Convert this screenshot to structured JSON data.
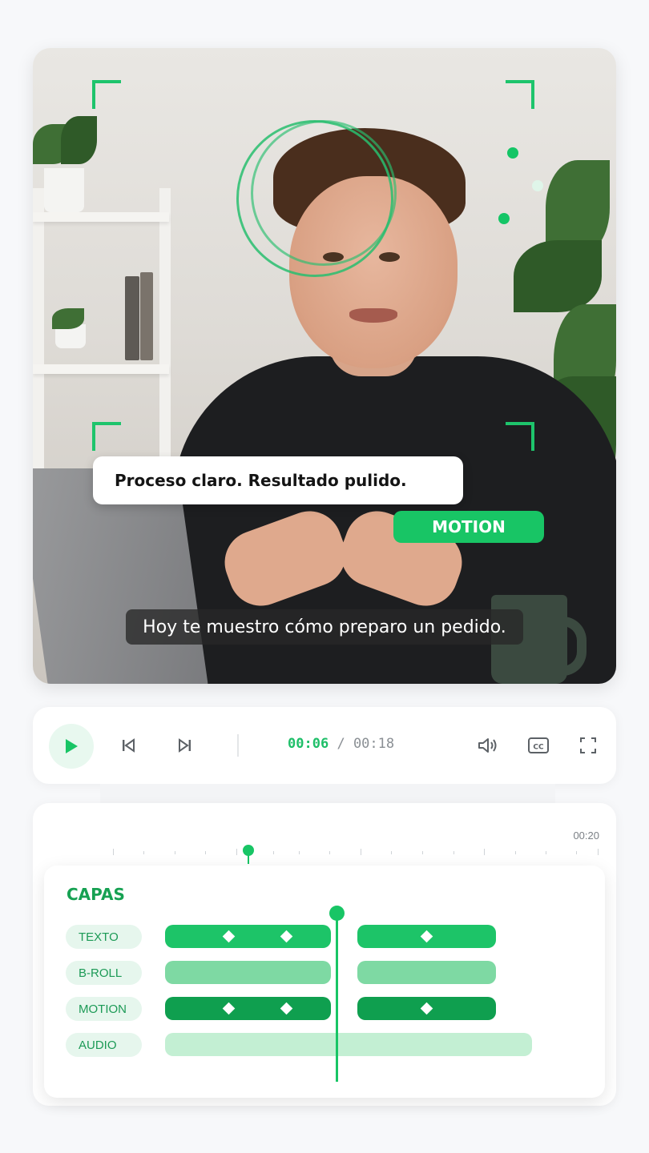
{
  "video": {
    "title_card": "Proceso claro. Resultado pulido.",
    "motion_tag": "MOTION",
    "subtitle": "Hoy te muestro cómo preparo un pedido."
  },
  "player": {
    "current_time": "00:06",
    "separator": "/",
    "total_time": "00:18",
    "icons": [
      "play-icon",
      "skip-back-icon",
      "skip-forward-icon",
      "volume-icon",
      "captions-icon",
      "fullscreen-icon"
    ],
    "cc_label": "CC"
  },
  "timeline": {
    "ruler_end_label": "00:20",
    "layers_title": "CAPAS",
    "layers": [
      {
        "label": "TEXTO",
        "type": "text"
      },
      {
        "label": "B-ROLL",
        "type": "broll"
      },
      {
        "label": "MOTION",
        "type": "motion"
      },
      {
        "label": "AUDIO",
        "type": "audio"
      }
    ]
  },
  "colors": {
    "accent": "#18c565",
    "accent_dark": "#0f9f4f",
    "accent_light": "#7ed9a3",
    "accent_pale": "#c3efd3",
    "layers_title": "#16a152"
  }
}
